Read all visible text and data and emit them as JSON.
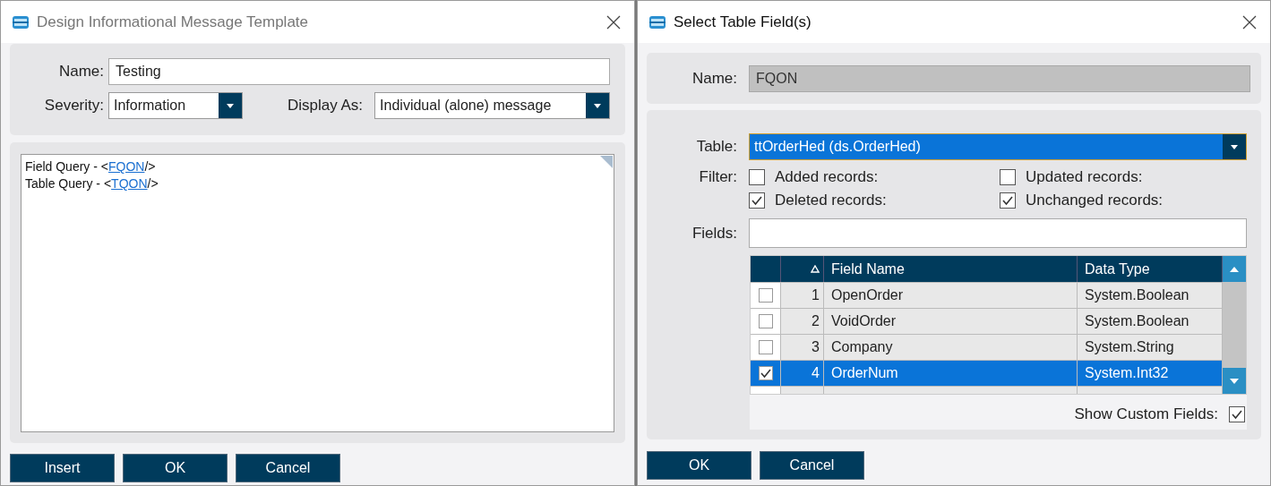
{
  "template_dialog": {
    "title": "Design Informational Message Template",
    "name": {
      "label": "Name:",
      "value": "Testing"
    },
    "severity": {
      "label": "Severity:",
      "value": "Information"
    },
    "display_as": {
      "label": "Display As:",
      "value": "Individual (alone) message"
    },
    "editor_lines": [
      {
        "prefix": "Field Query - <",
        "link": "FQON",
        "suffix": "/>"
      },
      {
        "prefix": "Table Query - <",
        "link": "TQON",
        "suffix": "/>"
      }
    ],
    "buttons": [
      "Insert",
      "OK",
      "Cancel"
    ]
  },
  "field_dialog": {
    "title": "Select Table Field(s)",
    "name": {
      "label": "Name:",
      "value": "FQON",
      "disabled": true
    },
    "table": {
      "label": "Table:",
      "value": "ttOrderHed (ds.OrderHed)"
    },
    "filter": {
      "label": "Filter:",
      "options": [
        {
          "label": "Added records:",
          "checked": false
        },
        {
          "label": "Updated records:",
          "checked": false
        },
        {
          "label": "Deleted records:",
          "checked": true
        },
        {
          "label": "Unchanged records:",
          "checked": true
        }
      ]
    },
    "fields": {
      "label": "Fields:"
    },
    "grid": {
      "columns": [
        "Field Name",
        "Data Type"
      ],
      "rows": [
        {
          "checked": false,
          "selected": false,
          "number": "1",
          "field_name": "OpenOrder",
          "data_type": "System.Boolean"
        },
        {
          "checked": false,
          "selected": false,
          "number": "2",
          "field_name": "VoidOrder",
          "data_type": "System.Boolean"
        },
        {
          "checked": false,
          "selected": false,
          "number": "3",
          "field_name": "Company",
          "data_type": "System.String"
        },
        {
          "checked": true,
          "selected": true,
          "number": "4",
          "field_name": "OrderNum",
          "data_type": "System.Int32"
        }
      ]
    },
    "show_custom_fields": {
      "label": "Show Custom Fields:",
      "checked": true
    },
    "buttons": [
      "OK",
      "Cancel"
    ]
  }
}
